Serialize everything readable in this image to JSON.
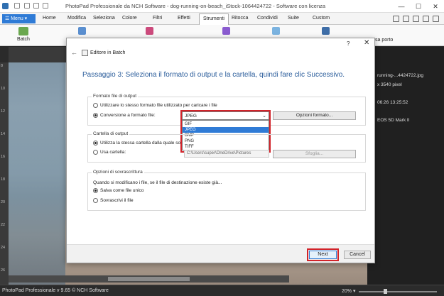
{
  "titlebar": {
    "title": "PhotoPad Professionale da NCH Software - dog-running-on-beach_iStock-1064424722 - Software con licenza",
    "minimize": "—",
    "maximize": "☐",
    "close": "✕"
  },
  "menubar": {
    "menu_label": "☰ Menu ▾",
    "items": [
      "Home",
      "Modifica",
      "Seleziona",
      "Colore",
      "Filtri",
      "Effetti",
      "Strumenti",
      "Ritocca",
      "Condividi",
      "Suite",
      "Custom"
    ],
    "active": "Strumenti"
  },
  "toolbar": {
    "batch_label": "Batch",
    "partial_label": "sa porto"
  },
  "ruler": {
    "left_ticks": [
      "8",
      "10",
      "12",
      "14",
      "16",
      "18",
      "20",
      "22",
      "24",
      "26"
    ]
  },
  "right_panel": {
    "lines": [
      "running-...4424722.jpg",
      "x 3540 pixel",
      "06:26 13:25:52",
      "EOS 5D Mark II"
    ]
  },
  "statusbar": {
    "text": "PhotoPad Professionale v 9.65 © NCH Software",
    "zoom": "20% ▾"
  },
  "dialog": {
    "help": "?",
    "close": "✕",
    "back": "←",
    "title": "Editore in Batch",
    "heading": "Passaggio 3: Seleziona il formato di output e la cartella, quindi fare clic Successivo.",
    "format_group": {
      "title": "Formato file di output",
      "option_same": "Utilizzare lo stesso formato file utilizzato per caricare i file",
      "option_convert": "Conversione a formato file:",
      "selected": "JPEG",
      "options": [
        "GIF",
        "JPEG",
        "BMP",
        "PNG",
        "TIFF"
      ],
      "options_button": "Opzioni formato..."
    },
    "folder_group": {
      "title": "Cartella di output",
      "option_same": "Utilizza la stessa cartella dalla quale so",
      "option_use": "Usa cartella:",
      "path": "C:\\Users\\super\\OneDrive\\Pictures",
      "browse": "Sfoglia..."
    },
    "overwrite_group": {
      "title": "Opzioni di sovrascrittura",
      "question": "Quando si modificano i file, se il file di destinazione esiste già...",
      "option_unique": "Salva come file unico",
      "option_overwrite": "Sovrascrivi il file"
    },
    "next": "Next",
    "cancel": "Cancel"
  },
  "colors": {
    "accent": "#2f7bd6",
    "heading": "#2b5d9b",
    "highlight": "#d2232a"
  }
}
